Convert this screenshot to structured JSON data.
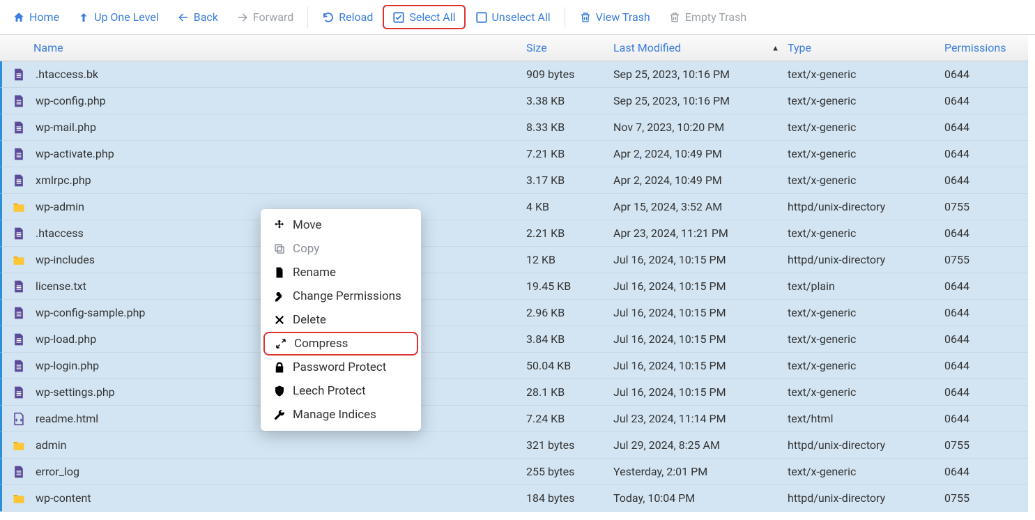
{
  "toolbar": {
    "home": "Home",
    "up": "Up One Level",
    "back": "Back",
    "forward": "Forward",
    "reload": "Reload",
    "select_all": "Select All",
    "unselect_all": "Unselect All",
    "view_trash": "View Trash",
    "empty_trash": "Empty Trash"
  },
  "columns": {
    "name": "Name",
    "size": "Size",
    "modified": "Last Modified",
    "type": "Type",
    "permissions": "Permissions"
  },
  "files": [
    {
      "icon": "file",
      "name": ".htaccess.bk",
      "size": "909 bytes",
      "modified": "Sep 25, 2023, 10:16 PM",
      "type": "text/x-generic",
      "perm": "0644"
    },
    {
      "icon": "file",
      "name": "wp-config.php",
      "size": "3.38 KB",
      "modified": "Sep 25, 2023, 10:16 PM",
      "type": "text/x-generic",
      "perm": "0644"
    },
    {
      "icon": "file",
      "name": "wp-mail.php",
      "size": "8.33 KB",
      "modified": "Nov 7, 2023, 10:20 PM",
      "type": "text/x-generic",
      "perm": "0644"
    },
    {
      "icon": "file",
      "name": "wp-activate.php",
      "size": "7.21 KB",
      "modified": "Apr 2, 2024, 10:49 PM",
      "type": "text/x-generic",
      "perm": "0644"
    },
    {
      "icon": "file",
      "name": "xmlrpc.php",
      "size": "3.17 KB",
      "modified": "Apr 2, 2024, 10:49 PM",
      "type": "text/x-generic",
      "perm": "0644"
    },
    {
      "icon": "folder",
      "name": "wp-admin",
      "size": "4 KB",
      "modified": "Apr 15, 2024, 3:52 AM",
      "type": "httpd/unix-directory",
      "perm": "0755"
    },
    {
      "icon": "file",
      "name": ".htaccess",
      "size": "2.21 KB",
      "modified": "Apr 23, 2024, 11:21 PM",
      "type": "text/x-generic",
      "perm": "0644"
    },
    {
      "icon": "folder",
      "name": "wp-includes",
      "size": "12 KB",
      "modified": "Jul 16, 2024, 10:15 PM",
      "type": "httpd/unix-directory",
      "perm": "0755"
    },
    {
      "icon": "file",
      "name": "license.txt",
      "size": "19.45 KB",
      "modified": "Jul 16, 2024, 10:15 PM",
      "type": "text/plain",
      "perm": "0644"
    },
    {
      "icon": "file",
      "name": "wp-config-sample.php",
      "size": "2.96 KB",
      "modified": "Jul 16, 2024, 10:15 PM",
      "type": "text/x-generic",
      "perm": "0644"
    },
    {
      "icon": "file",
      "name": "wp-load.php",
      "size": "3.84 KB",
      "modified": "Jul 16, 2024, 10:15 PM",
      "type": "text/x-generic",
      "perm": "0644"
    },
    {
      "icon": "file",
      "name": "wp-login.php",
      "size": "50.04 KB",
      "modified": "Jul 16, 2024, 10:15 PM",
      "type": "text/x-generic",
      "perm": "0644"
    },
    {
      "icon": "file",
      "name": "wp-settings.php",
      "size": "28.1 KB",
      "modified": "Jul 16, 2024, 10:15 PM",
      "type": "text/x-generic",
      "perm": "0644"
    },
    {
      "icon": "html",
      "name": "readme.html",
      "size": "7.24 KB",
      "modified": "Jul 23, 2024, 11:14 PM",
      "type": "text/html",
      "perm": "0644"
    },
    {
      "icon": "folder",
      "name": "admin",
      "size": "321 bytes",
      "modified": "Jul 29, 2024, 8:25 AM",
      "type": "httpd/unix-directory",
      "perm": "0755"
    },
    {
      "icon": "file",
      "name": "error_log",
      "size": "255 bytes",
      "modified": "Yesterday, 2:01 PM",
      "type": "text/x-generic",
      "perm": "0644"
    },
    {
      "icon": "folder",
      "name": "wp-content",
      "size": "184 bytes",
      "modified": "Today, 10:04 PM",
      "type": "httpd/unix-directory",
      "perm": "0755"
    }
  ],
  "context_menu": {
    "move": "Move",
    "copy": "Copy",
    "rename": "Rename",
    "change_permissions": "Change Permissions",
    "delete": "Delete",
    "compress": "Compress",
    "password_protect": "Password Protect",
    "leech_protect": "Leech Protect",
    "manage_indices": "Manage Indices"
  }
}
